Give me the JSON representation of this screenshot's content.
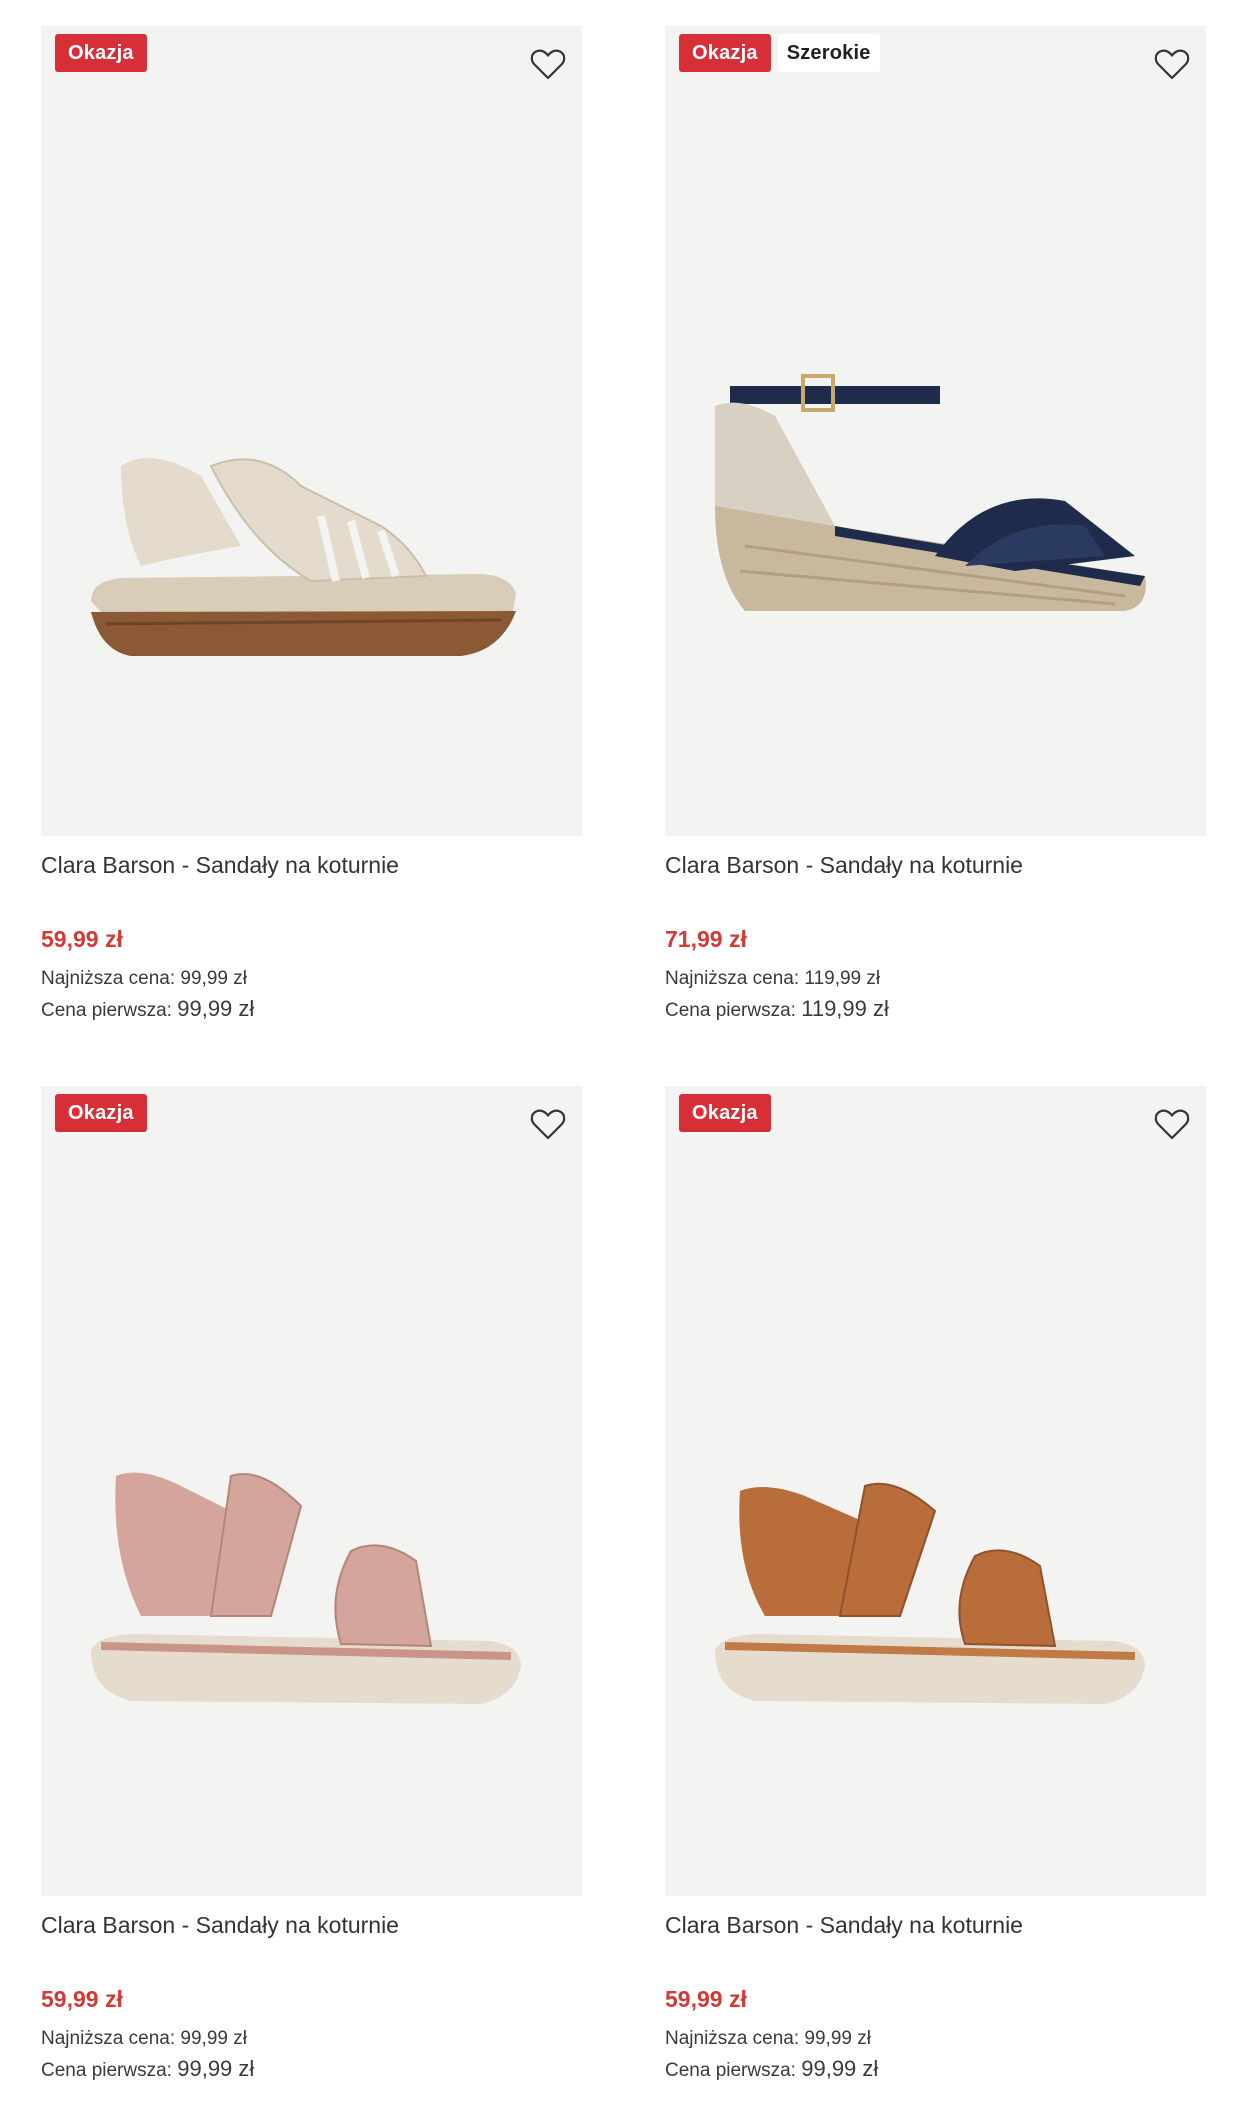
{
  "products": [
    {
      "badges": [
        "Okazja"
      ],
      "title": "Clara Barson - Sandały na koturnie",
      "price": "59,99 zł",
      "lowest_label": "Najniższa cena:",
      "lowest_value": "99,99 zł",
      "first_label": "Cena pierwsza:",
      "first_value": "99,99 zł",
      "colors": {
        "strap": "#e4dbcc",
        "sole": "#8b5a35",
        "footbed": "#d9ccb8"
      }
    },
    {
      "badges": [
        "Okazja",
        "Szerokie"
      ],
      "title": "Clara Barson - Sandały na koturnie",
      "price": "71,99 zł",
      "lowest_label": "Najniższa cena:",
      "lowest_value": "119,99 zł",
      "first_label": "Cena pierwsza:",
      "first_value": "119,99 zł",
      "colors": {
        "strap": "#1e2b4a",
        "sole": "#c8b89d",
        "heel": "#d8d0c3"
      }
    },
    {
      "badges": [
        "Okazja"
      ],
      "title": "Clara Barson - Sandały na koturnie",
      "price": "59,99 zł",
      "lowest_label": "Najniższa cena:",
      "lowest_value": "99,99 zł",
      "first_label": "Cena pierwsza:",
      "first_value": "99,99 zł",
      "colors": {
        "strap": "#d4a59a",
        "sole": "#e6dccd",
        "footbed": "#c99589"
      }
    },
    {
      "badges": [
        "Okazja"
      ],
      "title": "Clara Barson - Sandały na koturnie",
      "price": "59,99 zł",
      "lowest_label": "Najniższa cena:",
      "lowest_value": "99,99 zł",
      "first_label": "Cena pierwsza:",
      "first_value": "99,99 zł",
      "colors": {
        "strap": "#b86d3b",
        "sole": "#e6dccd",
        "footbed": "#c07a48"
      }
    }
  ],
  "icons": {
    "favorite": "heart-outline-icon"
  },
  "theme": {
    "sale_badge": "#d62f37",
    "price": "#d33a36",
    "image_bg": "#f3f3f1"
  }
}
